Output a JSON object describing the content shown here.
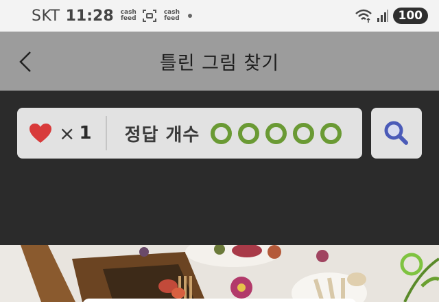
{
  "status_bar": {
    "carrier": "SKT",
    "time": "11:28",
    "cashfeed_top": "cash",
    "cashfeed_bottom": "feed",
    "battery": "100"
  },
  "header": {
    "title": "틀린 그림 찾기"
  },
  "game_info": {
    "lives_symbol": "×",
    "lives": "1",
    "answer_label": "정답 개수",
    "answers_total": 5,
    "answers_found": 0,
    "circle_color": "#6a9a34",
    "heart_color": "#d83a3a"
  },
  "icons": [
    "back-chevron-icon",
    "heart-icon",
    "search-icon",
    "wifi-icon",
    "signal-icon"
  ]
}
